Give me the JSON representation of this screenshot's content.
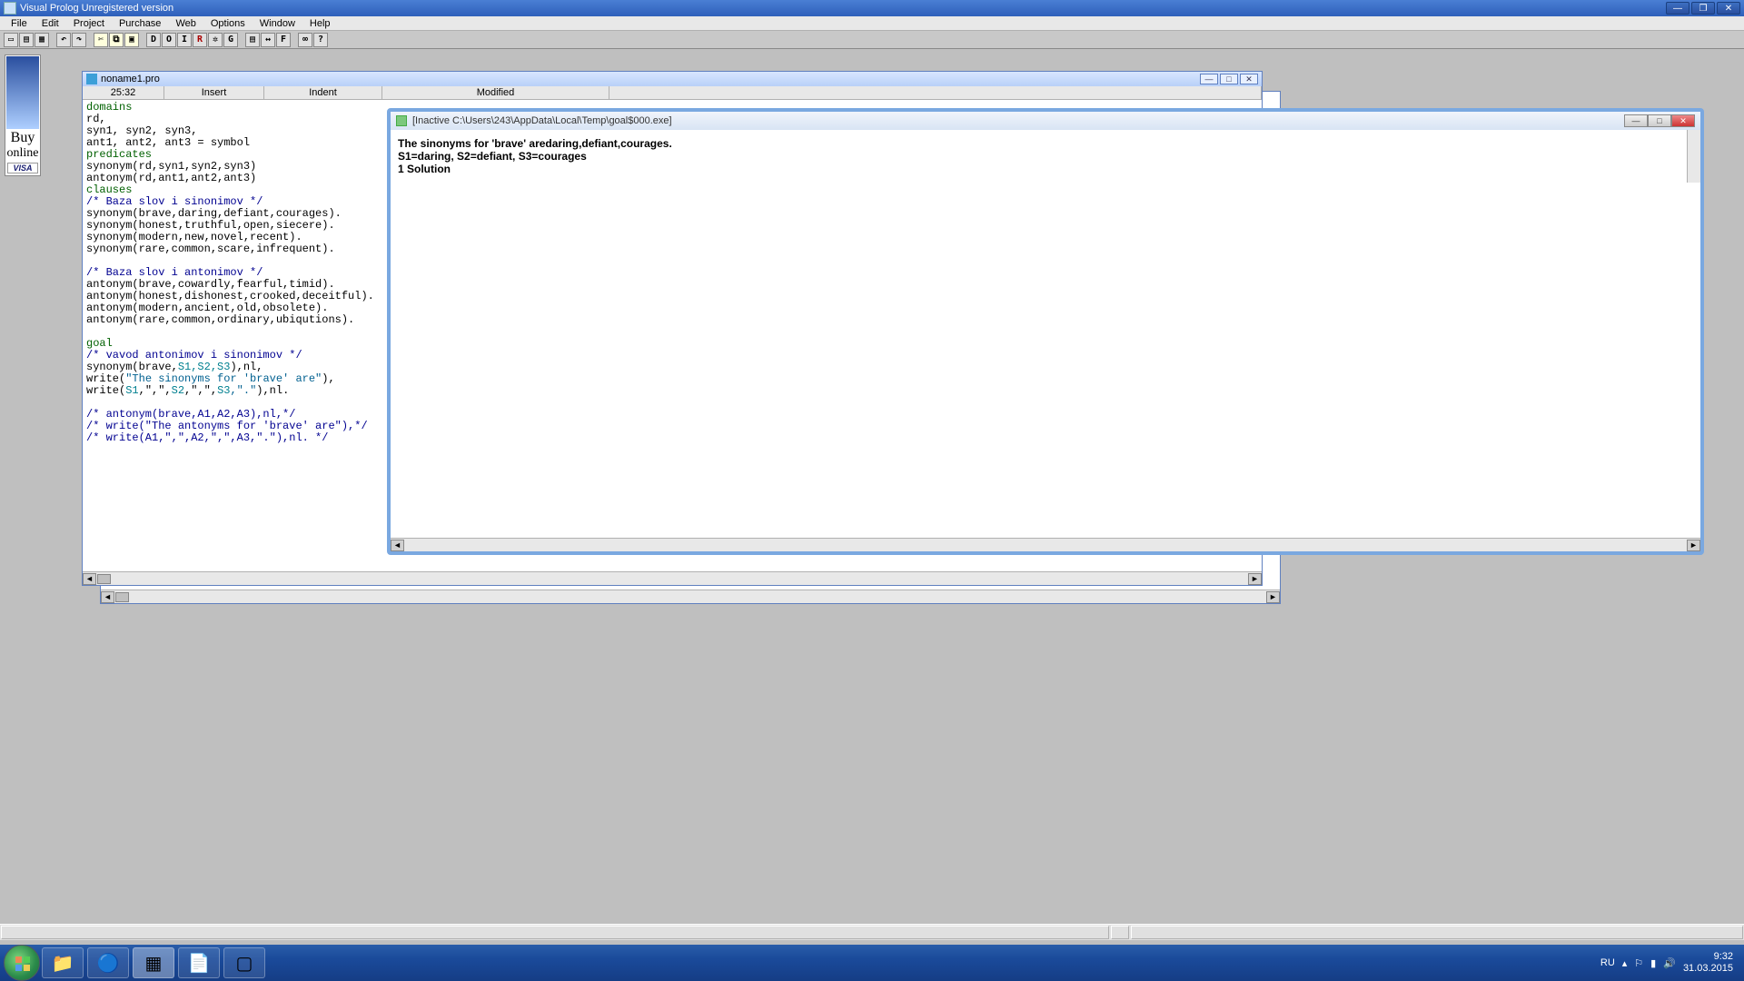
{
  "title": "Visual Prolog Unregistered version",
  "menu": [
    "File",
    "Edit",
    "Project",
    "Purchase",
    "Web",
    "Options",
    "Window",
    "Help"
  ],
  "toolbar_letters": [
    "D",
    "O",
    "I",
    "R",
    "G",
    "F"
  ],
  "ad": {
    "line1": "Buy",
    "line2": "online"
  },
  "editor": {
    "filename": "noname1.pro",
    "status": {
      "pos": "25:32",
      "mode1": "Insert",
      "mode2": "Indent",
      "mode3": "Modified"
    },
    "code": {
      "l1": "domains",
      "l2": "rd,",
      "l3": "syn1, syn2, syn3,",
      "l4": "ant1, ant2, ant3 = symbol",
      "l5": "predicates",
      "l6": "synonym(rd,syn1,syn2,syn3)",
      "l7": "antonym(rd,ant1,ant2,ant3)",
      "l8": "clauses",
      "l9": "/* Baza slov i sinonimov */",
      "l10": "synonym(brave,daring,defiant,courages).",
      "l11": "synonym(honest,truthful,open,siecere).",
      "l12": "synonym(modern,new,novel,recent).",
      "l13": "synonym(rare,common,scare,infrequent).",
      "l14": "/* Baza slov i antonimov */",
      "l15": "antonym(brave,cowardly,fearful,timid).",
      "l16": "antonym(honest,dishonest,crooked,deceitful).",
      "l17": "antonym(modern,ancient,old,obsolete).",
      "l18": "antonym(rare,common,ordinary,ubiqutions).",
      "l19": "goal",
      "l20": "/* vavod antonimov i sinonimov */",
      "l21a": "synonym(brave,",
      "l21b": "S1,S2,S3",
      "l21c": "),nl,",
      "l22a": "write(",
      "l22b": "\"The sinonyms for 'brave' are\"",
      "l22c": "),",
      "l23a": "write(",
      "l23b": "S1",
      "l23c": ",\",\",",
      "l23d": "S2",
      "l23e": ",\",\",",
      "l23f": "S3",
      "l23g": ",\".\"",
      "l23h": "),nl.",
      "l24": "/* antonym(brave,A1,A2,A3),nl,*/",
      "l25": "/* write(\"The antonyms for 'brave' are\"),*/",
      "l26": "/* write(A1,\",\",A2,\",\",A3,\".\"),nl. */"
    }
  },
  "output": {
    "title": "[Inactive C:\\Users\\243\\AppData\\Local\\Temp\\goal$000.exe]",
    "line1": "The sinonyms for 'brave' aredaring,defiant,courages.",
    "line2": "S1=daring, S2=defiant, S3=courages",
    "line3": "1 Solution"
  },
  "tray": {
    "lang": "RU",
    "time": "9:32",
    "date": "31.03.2015"
  }
}
